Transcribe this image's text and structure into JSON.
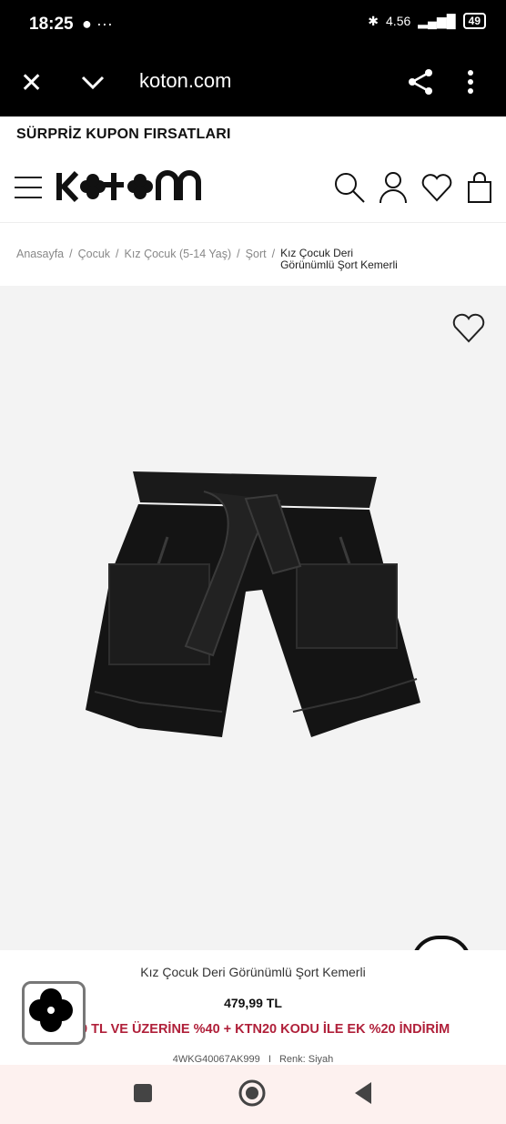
{
  "status_bar": {
    "time": "18:25",
    "network": "4.56",
    "battery": "49"
  },
  "browser": {
    "url": "koton.com"
  },
  "promo": {
    "text": "SÜRPRİZ KUPON FIRSATLARI"
  },
  "header": {
    "brand": "KOTON"
  },
  "breadcrumb": {
    "items": [
      "Anasayfa",
      "Çocuk",
      "Kız Çocuk (5-14 Yaş)",
      "Şort"
    ],
    "current_line1": "Kız Çocuk Deri",
    "current_line2": "Görünümlü Şort Kemerli",
    "separator": "/"
  },
  "product": {
    "name": "Kız Çocuk Deri Görünümlü Şort Kemerli",
    "price": "479,99 TL",
    "deal": "0 TL VE ÜZERİNE %40 + KTN20 KODU İLE EK %20 İNDİRİM",
    "sku": "4WKG40067AK999",
    "sku_sep": "I",
    "color": "Renk: Siyah"
  },
  "colors": {
    "deal": "#b0203a",
    "hero_bg": "#f3f3f3",
    "nav_bg": "#fdf1ef"
  }
}
